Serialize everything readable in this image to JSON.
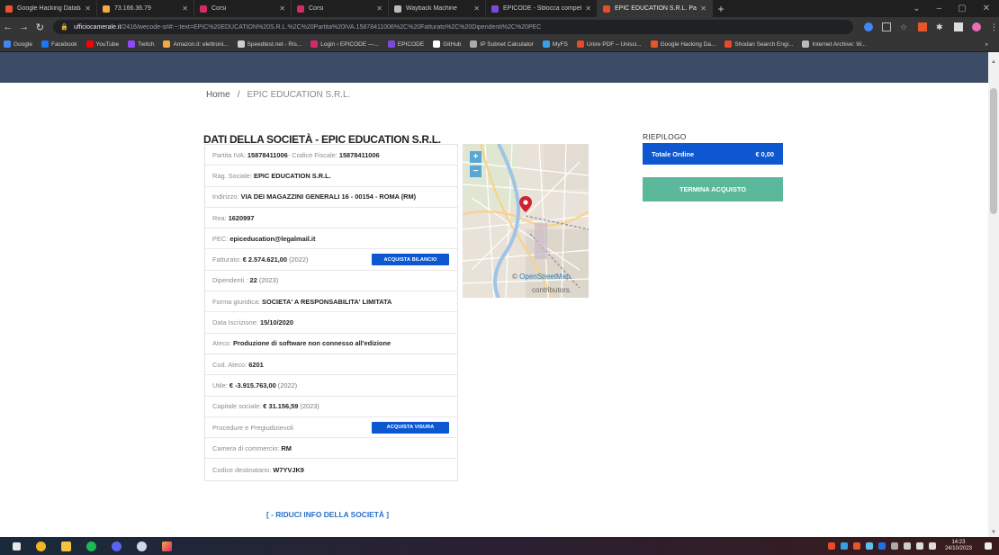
{
  "browser": {
    "tabs": [
      {
        "label": "Google Hacking Database (GH",
        "color": "#e8542b",
        "active": false
      },
      {
        "label": "73.166.36.79",
        "color": "#f5a742",
        "active": false
      },
      {
        "label": "Corsi",
        "color": "#d42a6a",
        "active": false
      },
      {
        "label": "Corsi",
        "color": "#d42a6a",
        "active": false
      },
      {
        "label": "Wayback Machine",
        "color": "#bbbbbb",
        "active": false
      },
      {
        "label": "EPICODE - Sblocca competenz",
        "color": "#7a4bd8",
        "active": false
      },
      {
        "label": "EPIC EDUCATION S.R.L. Partita",
        "color": "#e84a2b",
        "active": true
      }
    ],
    "new_tab": "+",
    "url_host": "ufficiocamerale.it",
    "url_path": "/2416/wecode-srl#:~:text=EPIC%20EDUCATION%20S.R.L.%2C%20Partita%20IVA.15878411006%2C%20Fatturato%2C%20Dipendenti%2C%20PEC",
    "bookmarks": [
      {
        "label": "Google",
        "color": "#4285f4"
      },
      {
        "label": "Facebook",
        "color": "#1877f2"
      },
      {
        "label": "YouTube",
        "color": "#ff0000"
      },
      {
        "label": "Twitch",
        "color": "#9146ff"
      },
      {
        "label": "Amazon.it: elettroni...",
        "color": "#f3a847"
      },
      {
        "label": "Speedtest.net - Ris...",
        "color": "#cfcfcf"
      },
      {
        "label": "Login ‹ EPICODE —...",
        "color": "#d42a6a"
      },
      {
        "label": "EPICODE",
        "color": "#7a4bd8"
      },
      {
        "label": "GitHub",
        "color": "#ffffff"
      },
      {
        "label": "IP Subnet Calculator",
        "color": "#aaaaaa"
      },
      {
        "label": "MyFS",
        "color": "#3aa0e6"
      },
      {
        "label": "Unire PDF – Unisci...",
        "color": "#e84a2b"
      },
      {
        "label": "Google Hacking Da...",
        "color": "#e8542b"
      },
      {
        "label": "Shodan Search Engi...",
        "color": "#e84a2b"
      },
      {
        "label": "Internet Archive: W...",
        "color": "#bbbbbb"
      }
    ],
    "more_bookmarks": "»"
  },
  "breadcrumb": {
    "home": "Home",
    "separator": "/",
    "current": "EPIC EDUCATION S.R.L."
  },
  "company": {
    "title": "DATI DELLA SOCIETÀ - EPIC EDUCATION S.R.L.",
    "rows": [
      {
        "label": "Partita IVA:",
        "value": "15878411006",
        "label2": " - Codice Fiscale:",
        "value2": "15878411006"
      },
      {
        "label": "Rag. Sociale:",
        "value": "EPIC EDUCATION S.R.L."
      },
      {
        "label": "Indirizzo:",
        "value": "VIA DEI MAGAZZINI GENERALI 16 - 00154 - ROMA (RM)"
      },
      {
        "label": "Rea:",
        "value": "1620997"
      },
      {
        "label": "PEC:",
        "value": "epiceducation@legalmail.it"
      },
      {
        "label": "Fatturato:",
        "value": "€ 2.574.621,00",
        "extra": "(2022)",
        "button": "ACQUISTA BILANCIO"
      },
      {
        "label": "Dipendenti :",
        "value": "22",
        "extra": "(2023)"
      },
      {
        "label": "Forma giuridica:",
        "value": "SOCIETA' A RESPONSABILITA' LIMITATA"
      },
      {
        "label": "Data Iscrizione:",
        "value": "15/10/2020"
      },
      {
        "label": "Ateco:",
        "value": "Produzione di software non connesso all'edizione"
      },
      {
        "label": "Cod. Ateco:",
        "value": "6201"
      },
      {
        "label": "Utile:",
        "value": "€ -3.915.763,00",
        "extra": "(2022)"
      },
      {
        "label": "Capitale sociale:",
        "value": "€ 31.156,59",
        "extra": "(2023)"
      },
      {
        "label": "Procedure e Pregiudizievoli",
        "value": "",
        "button": "ACQUISTA VISURA"
      },
      {
        "label": "Camera di commercio:",
        "value": "RM"
      },
      {
        "label": "Codice destinatario:",
        "value": "W7YVJK9"
      }
    ],
    "reduce_link": "[ - RIDUCI INFO DELLA SOCIETÀ ]"
  },
  "map": {
    "zoom_in": "+",
    "zoom_out": "−",
    "attribution_symbol": "©",
    "attribution_link": "OpenStreetMap",
    "attribution_text": "contributors."
  },
  "summary": {
    "title": "RIEPILOGO",
    "order_label": "Totale Ordine",
    "order_value": "€ 0,00",
    "checkout_button": "TERMINA ACQUISTO"
  },
  "taskbar": {
    "time": "14:23",
    "date": "24/10/2023"
  },
  "colors": {
    "brand_blue": "#0d57d1",
    "checkout_green": "#5cb89a",
    "nav_dark": "#3c4b66",
    "map_marker": "#d2202f"
  }
}
